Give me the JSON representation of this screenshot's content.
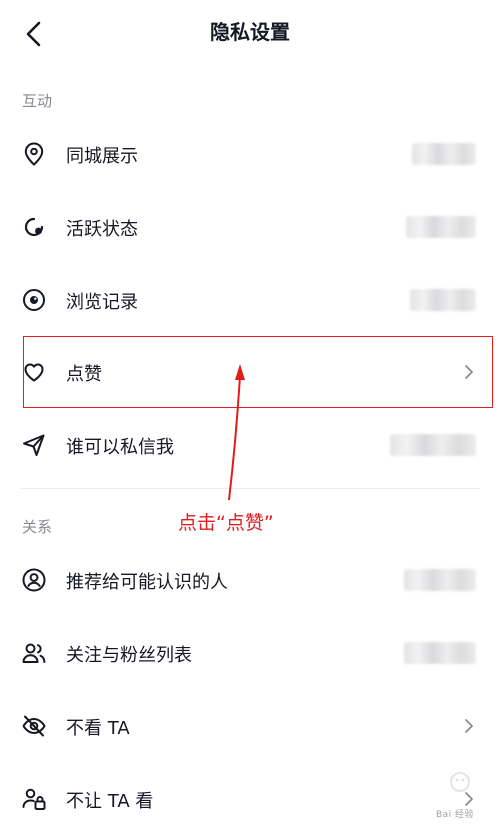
{
  "header": {
    "title": "隐私设置"
  },
  "sections": {
    "interaction": {
      "label": "互动",
      "items": [
        {
          "name": "同城展示",
          "icon": "location-icon"
        },
        {
          "name": "活跃状态",
          "icon": "activity-status-icon"
        },
        {
          "name": "浏览记录",
          "icon": "eye-icon"
        },
        {
          "name": "点赞",
          "icon": "heart-icon"
        },
        {
          "name": "谁可以私信我",
          "icon": "send-icon"
        }
      ]
    },
    "relations": {
      "label": "关系",
      "items": [
        {
          "name": "推荐给可能认识的人",
          "icon": "user-circle-icon"
        },
        {
          "name": "关注与粉丝列表",
          "icon": "users-icon"
        },
        {
          "name": "不看 TA",
          "icon": "eye-off-icon"
        },
        {
          "name": "不让 TA 看",
          "icon": "user-lock-icon"
        }
      ]
    }
  },
  "annotation": {
    "text": "点击“点赞”",
    "color": "#e11c1c"
  },
  "watermark": {
    "text": "Bai 经验"
  }
}
